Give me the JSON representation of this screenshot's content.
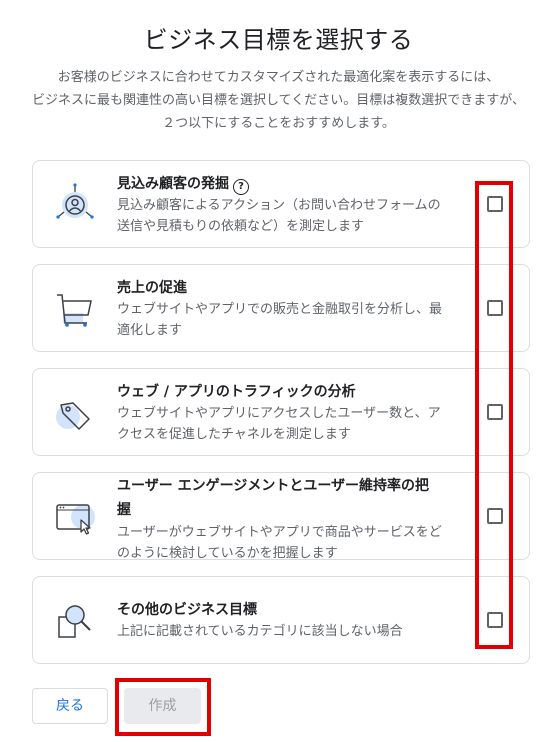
{
  "page": {
    "title": "ビジネス目標を選択する",
    "description_lines": [
      "お客様のビジネスに合わせてカスタマイズされた最適化案を表示するには、",
      "ビジネスに最も関連性の高い目標を選択してください。目標は複数選択できますが、",
      "２つ以下にすることをおすすめします。"
    ]
  },
  "goals": [
    {
      "title": "見込み顧客の発掘",
      "help_icon": "?",
      "desc_lines": [
        "見込み顧客によるアクション（お問い合わせフォームの",
        "送信や見積もりの依頼など）を測定します"
      ],
      "icon": "lead-target-icon",
      "checked": false
    },
    {
      "title": "売上の促進",
      "desc_lines": [
        "ウェブサイトやアプリでの販売と金融取引を分析し、最",
        "適化します"
      ],
      "icon": "shopping-cart-icon",
      "checked": false
    },
    {
      "title": "ウェブ / アプリのトラフィックの分析",
      "desc_lines": [
        "ウェブサイトやアプリにアクセスしたユーザー数と、ア",
        "クセスを促進したチャネルを測定します"
      ],
      "icon": "tag-icon",
      "checked": false
    },
    {
      "title_lines": [
        "ユーザー エンゲージメントとユーザー維持率の把",
        "握"
      ],
      "desc_lines": [
        "ユーザーがウェブサイトやアプリで商品やサービスをど",
        "のように検討しているかを把握します"
      ],
      "icon": "browser-cursor-icon",
      "checked": false
    },
    {
      "title": "その他のビジネス目標",
      "desc_lines": [
        "上記に記載されているカテゴリに該当しない場合"
      ],
      "icon": "magnifier-icon",
      "checked": false
    }
  ],
  "buttons": {
    "back": "戻る",
    "create": "作成"
  },
  "colors": {
    "accent": "#1a73e8",
    "highlight": "#e00000",
    "icon_bg": "#d2e3fc"
  }
}
